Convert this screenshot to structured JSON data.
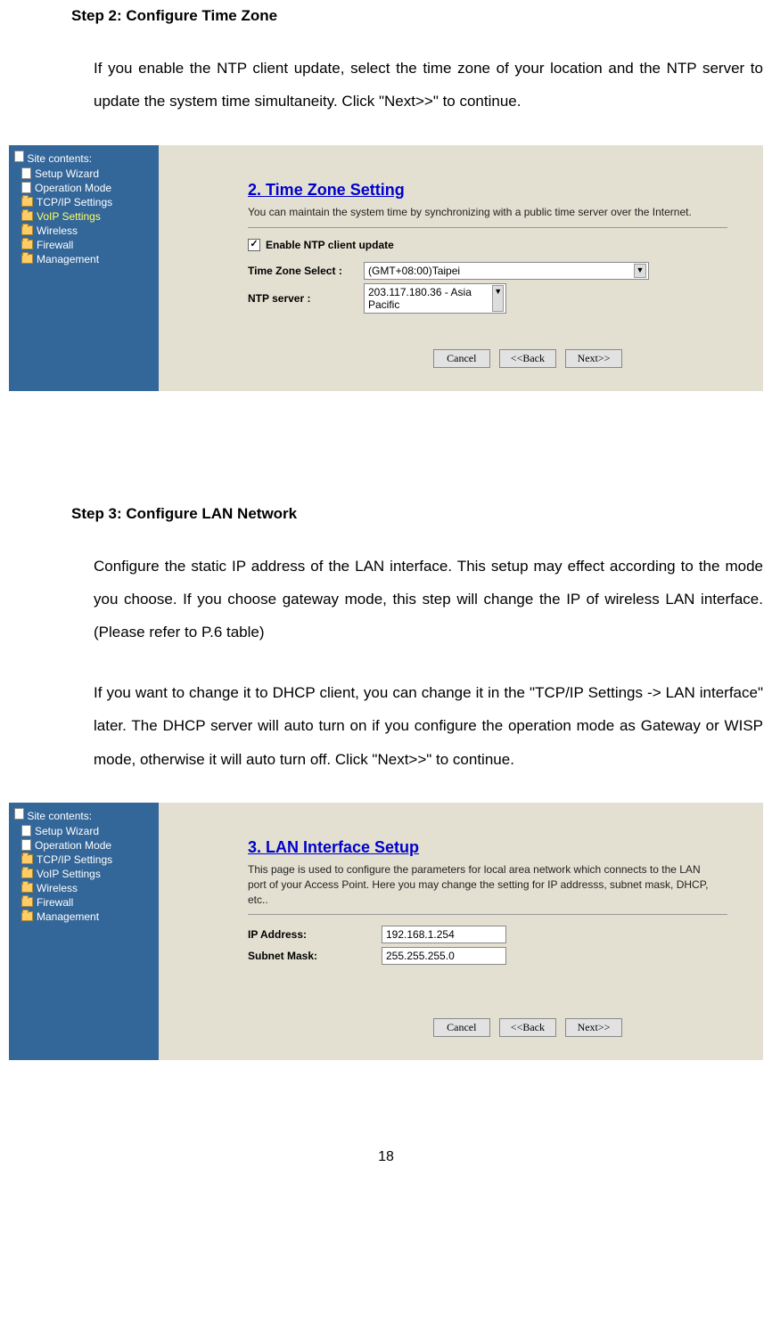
{
  "step2": {
    "title": "Step 2: Configure Time Zone",
    "body": "If you enable the NTP client update, select the time zone of your location and the NTP server to update the system time simultaneity. Click \"Next>>\" to continue."
  },
  "step3": {
    "title": "Step 3: Configure LAN Network",
    "body1": "Configure the static IP address of the LAN interface. This setup may effect according to the mode you choose. If you choose gateway mode, this step will change the IP of wireless LAN interface. (Please refer to P.6 table)",
    "body2": "If you want to change it to DHCP client, you can change it in the \"TCP/IP Settings -> LAN interface\" later. The DHCP server will auto turn on if you configure the operation mode as Gateway or WISP mode, otherwise it will auto turn off. Click \"Next>>\" to continue."
  },
  "sidebar": {
    "title": "Site contents:",
    "items": [
      {
        "label": "Setup Wizard",
        "icon": "doc"
      },
      {
        "label": "Operation Mode",
        "icon": "doc"
      },
      {
        "label": "TCP/IP Settings",
        "icon": "folder"
      },
      {
        "label": "VoIP Settings",
        "icon": "folder",
        "highlight": true
      },
      {
        "label": "Wireless",
        "icon": "folder"
      },
      {
        "label": "Firewall",
        "icon": "folder"
      },
      {
        "label": "Management",
        "icon": "folder"
      }
    ]
  },
  "panel_tz": {
    "title": "2. Time Zone Setting",
    "desc": "You can maintain the system time by synchronizing with a public time server over the Internet.",
    "enable_label": "Enable NTP client update",
    "tz_label": "Time Zone Select :",
    "tz_value": "(GMT+08:00)Taipei",
    "ntp_label": "NTP server :",
    "ntp_value": "203.117.180.36 - Asia Pacific"
  },
  "panel_lan": {
    "title": "3. LAN Interface Setup",
    "desc": "This page is used to configure the parameters for local area network which connects to the LAN port of your Access Point. Here you may change the setting for IP addresss, subnet mask, DHCP, etc..",
    "ip_label": "IP Address:",
    "ip_value": "192.168.1.254",
    "mask_label": "Subnet Mask:",
    "mask_value": "255.255.255.0"
  },
  "buttons": {
    "cancel": "Cancel",
    "back": "<<Back",
    "next": "Next>>"
  },
  "page_number": "18"
}
